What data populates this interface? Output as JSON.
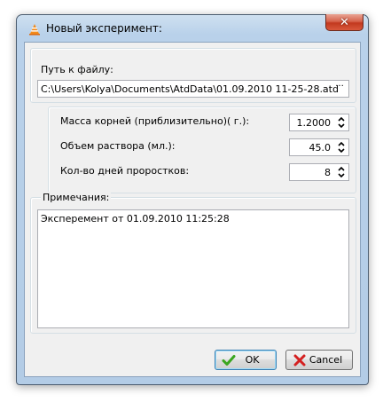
{
  "window": {
    "title": "Новый эксперимент:",
    "close_label": "✕",
    "app_icon": "vlc-cone-icon"
  },
  "file": {
    "label": "Путь к файлу:",
    "path": "C:\\Users\\Kolya\\Documents\\AtdData\\01.09.2010 11-25-28.atd",
    "browse_label": "···"
  },
  "params": [
    {
      "label": "Масса корней (приблизительно)( г.):",
      "value": "1.2000"
    },
    {
      "label": "Объем раствора (мл.):",
      "value": "45.0"
    },
    {
      "label": "Кол-во дней проростков:",
      "value": "8"
    }
  ],
  "notes": {
    "label": "Примечания:",
    "text": "Эксперемент от 01.09.2010 11:25:28"
  },
  "buttons": {
    "ok": "OK",
    "cancel": "Cancel"
  },
  "colors": {
    "ok_check": "#3aa61f",
    "cancel_x": "#d42020"
  }
}
